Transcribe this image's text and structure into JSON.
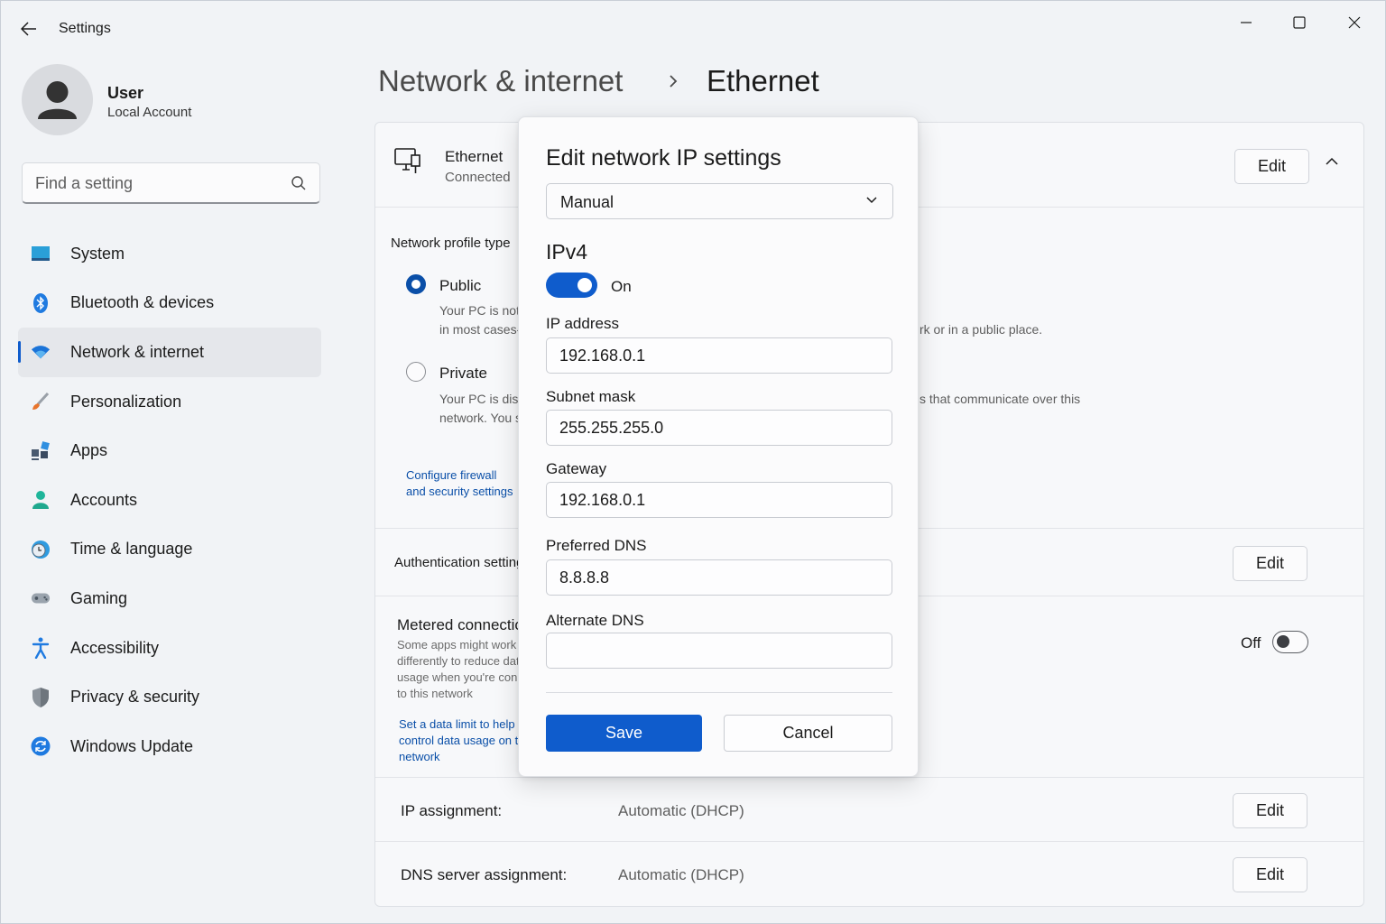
{
  "window": {
    "title": "Settings",
    "controls": {
      "minimize_icon": "minimize-icon",
      "maximize_icon": "maximize-icon",
      "close_icon": "close-icon"
    }
  },
  "user": {
    "name": "User",
    "account_type": "Local Account"
  },
  "search": {
    "placeholder": "Find a setting",
    "value": ""
  },
  "sidebar": {
    "items": [
      {
        "label": "System",
        "icon": "system-icon"
      },
      {
        "label": "Bluetooth & devices",
        "icon": "bluetooth-icon"
      },
      {
        "label": "Network & internet",
        "icon": "wifi-icon",
        "active": true
      },
      {
        "label": "Personalization",
        "icon": "brush-icon"
      },
      {
        "label": "Apps",
        "icon": "apps-icon"
      },
      {
        "label": "Accounts",
        "icon": "person-icon"
      },
      {
        "label": "Time & language",
        "icon": "clock-globe-icon"
      },
      {
        "label": "Gaming",
        "icon": "controller-icon"
      },
      {
        "label": "Accessibility",
        "icon": "accessibility-icon"
      },
      {
        "label": "Privacy & security",
        "icon": "shield-icon"
      },
      {
        "label": "Windows Update",
        "icon": "update-icon"
      }
    ]
  },
  "header": {
    "parent": "Network & internet",
    "separator": "›",
    "current": "Ethernet"
  },
  "ethernet": {
    "title": "Ethernet",
    "status": "Connected",
    "edit_label": "Edit",
    "network_profile_label": "Network profile type",
    "public_label": "Public",
    "public_desc_1": "Your PC is not",
    "public_desc_2": "in most cases-",
    "public_desc_tail": "rk or in a public place.",
    "private_label": "Private",
    "private_desc_1": "Your PC is disc",
    "private_desc_2": "network. You s",
    "private_desc_tail": "s that communicate over this",
    "firewall_link": "Configure firewall and security settings",
    "auth_label": "Authentication settings",
    "auth_edit_label": "Edit",
    "metered_title": "Metered connection",
    "metered_desc": "Some apps might work differently to reduce data usage when you're conne to this network",
    "metered_link": "Set a data limit to help control data usage on this network",
    "metered_state": "Off",
    "ip_assignment_label": "IP assignment:",
    "ip_assignment_value": "Automatic (DHCP)",
    "ip_assignment_edit": "Edit",
    "dns_assignment_label": "DNS server assignment:",
    "dns_assignment_value": "Automatic (DHCP)",
    "dns_assignment_edit": "Edit"
  },
  "dialog": {
    "title": "Edit network IP settings",
    "mode": "Manual",
    "section": "IPv4",
    "ipv4_state": "On",
    "ip_address_label": "IP address",
    "ip_address_value": "192.168.0.1",
    "subnet_label": "Subnet mask",
    "subnet_value": "255.255.255.0",
    "gateway_label": "Gateway",
    "gateway_value": "192.168.0.1",
    "preferred_dns_label": "Preferred DNS",
    "preferred_dns_value": "8.8.8.8",
    "alternate_dns_label": "Alternate DNS",
    "alternate_dns_value": "",
    "save_label": "Save",
    "cancel_label": "Cancel"
  },
  "colors": {
    "accent": "#0f5ccc",
    "link": "#0a4fa8",
    "background": "#f1f3f6"
  }
}
